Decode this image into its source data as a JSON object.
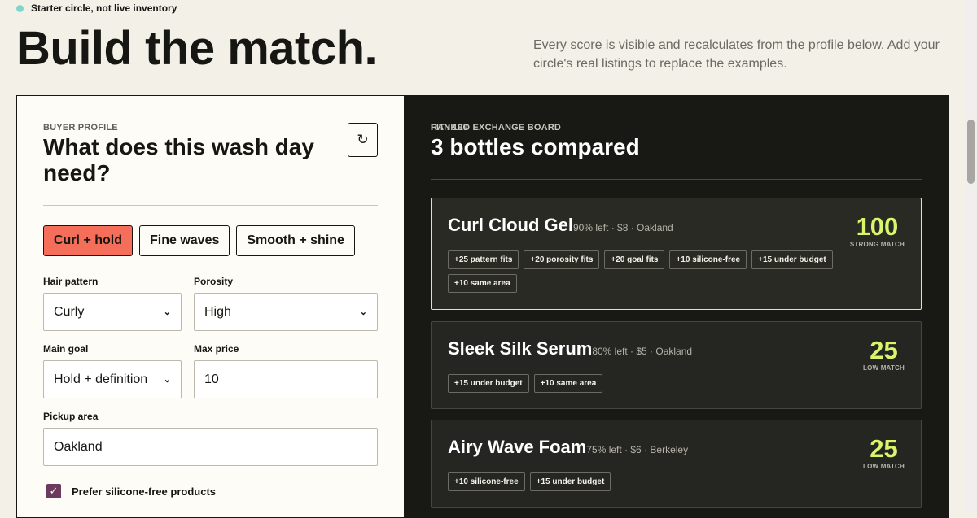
{
  "status": {
    "text": "Starter circle, not live inventory",
    "color": "#7fd6cc"
  },
  "hero": {
    "title": "Build the match.",
    "subtitle": "Every score is visible and recalculates from the profile below. Add your circle's real listings to replace the examples."
  },
  "profile": {
    "eyebrow": "BUYER PROFILE",
    "title": "What does this wash day need?",
    "reset_icon": "↻",
    "presets": [
      {
        "label": "Curl + hold",
        "active": true
      },
      {
        "label": "Fine waves",
        "active": false
      },
      {
        "label": "Smooth + shine",
        "active": false
      }
    ],
    "fields": {
      "hair_pattern": {
        "label": "Hair pattern",
        "value": "Curly"
      },
      "porosity": {
        "label": "Porosity",
        "value": "High"
      },
      "main_goal": {
        "label": "Main goal",
        "value": "Hold + definition"
      },
      "max_price": {
        "label": "Max price",
        "value": "10"
      },
      "pickup_area": {
        "label": "Pickup area",
        "value": "Oakland"
      }
    },
    "silicone_free": {
      "label": "Prefer silicone-free products",
      "checked": true
    }
  },
  "board": {
    "eyebrow": "RANKED EXCHANGE BOARD",
    "fit_label": "FIT / 100",
    "title": "3 bottles compared",
    "accent_color": "#d9f56b",
    "items": [
      {
        "name": "Curl Cloud Gel",
        "meta": "90% left · $8 · Oakland",
        "score": "100",
        "match": "STRONG MATCH",
        "tags": [
          "+25 pattern fits",
          "+20 porosity fits",
          "+20 goal fits",
          "+10 silicone-free",
          "+15 under budget",
          "+10 same area"
        ]
      },
      {
        "name": "Sleek Silk Serum",
        "meta": "80% left · $5 · Oakland",
        "score": "25",
        "match": "LOW MATCH",
        "tags": [
          "+15 under budget",
          "+10 same area"
        ]
      },
      {
        "name": "Airy Wave Foam",
        "meta": "75% left · $6 · Berkeley",
        "score": "25",
        "match": "LOW MATCH",
        "tags": [
          "+10 silicone-free",
          "+15 under budget"
        ]
      }
    ]
  }
}
